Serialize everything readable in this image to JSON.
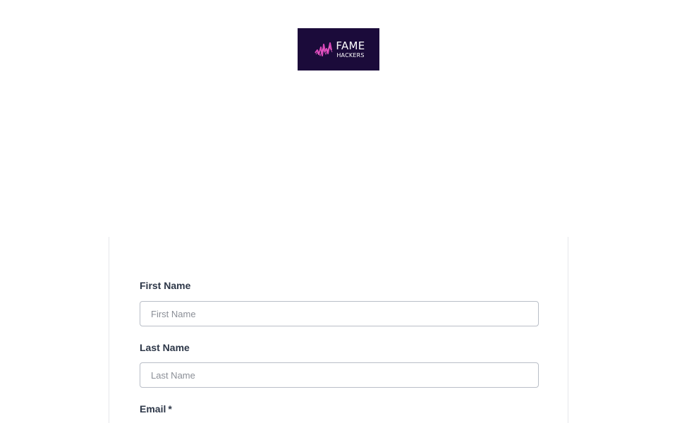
{
  "logo": {
    "line1": "FAME",
    "line2": "HACKERS",
    "background": "#1b0b3a",
    "accent": "#d946b8"
  },
  "form": {
    "fields": [
      {
        "label": "First Name",
        "placeholder": "First Name",
        "value": ""
      },
      {
        "label": "Last Name",
        "placeholder": "Last Name",
        "value": ""
      },
      {
        "label": "Email",
        "required_marker": "*"
      }
    ]
  }
}
